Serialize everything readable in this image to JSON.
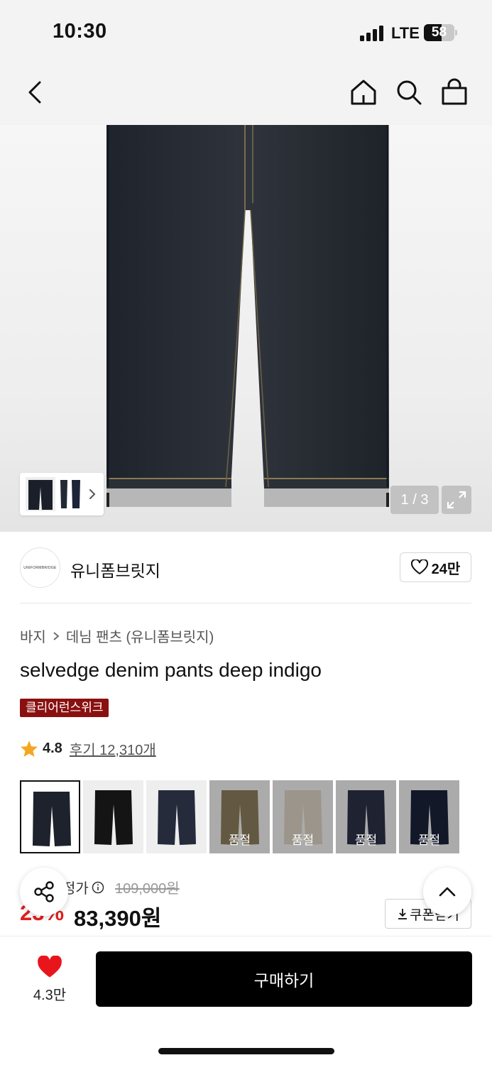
{
  "status_bar": {
    "time": "10:30",
    "network": "LTE",
    "battery": "58",
    "battery_level": 0.58
  },
  "header": {
    "back_icon": "chevron-left-icon",
    "home_icon": "home-icon",
    "search_icon": "search-icon",
    "cart_icon": "shopping-bag-icon"
  },
  "gallery": {
    "counter": "1 / 3",
    "expand_icon": "expand-icon"
  },
  "brand": {
    "logo_text": "UNIFORMBRIDGE",
    "name": "유니폼브릿지",
    "likes": "24만"
  },
  "breadcrumb": {
    "category": "바지",
    "subcategory": "데님 팬츠 (유니폼브릿지)"
  },
  "product": {
    "title": "selvedge denim pants deep indigo",
    "badge": "클리어런스위크",
    "rating": "4.8",
    "reviews": "후기 12,310개"
  },
  "colors": [
    {
      "color": "#1d222c",
      "soldout_label": "",
      "selected": true
    },
    {
      "color": "#141414",
      "soldout_label": "",
      "selected": false
    },
    {
      "color": "#252b3b",
      "soldout_label": "",
      "selected": false
    },
    {
      "color": "#8a7a5a",
      "soldout_label": "품절",
      "selected": false
    },
    {
      "color": "#d8cfc1",
      "soldout_label": "품절",
      "selected": false
    },
    {
      "color": "#2a3045",
      "soldout_label": "품절",
      "selected": false
    },
    {
      "color": "#1a2238",
      "soldout_label": "품절",
      "selected": false
    }
  ],
  "price": {
    "label": "정가",
    "original": "109,000원",
    "discount": "23%",
    "sale": "83,390원",
    "coupon": "쿠폰받기"
  },
  "bottom_bar": {
    "wish_count": "4.3만",
    "buy_label": "구매하기"
  },
  "accent": {
    "discount_red": "#e0201e",
    "badge_red": "#8a1010",
    "heart_red": "#e8161c"
  }
}
